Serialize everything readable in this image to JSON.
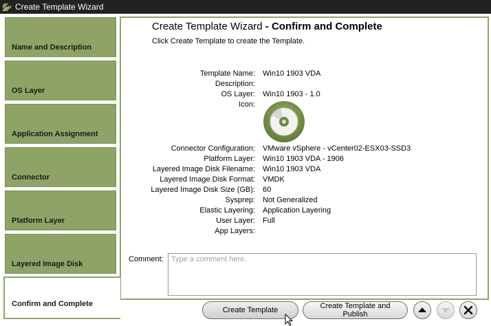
{
  "window": {
    "title": "Create Template Wizard"
  },
  "steps": [
    {
      "label": "Name and Description"
    },
    {
      "label": "OS Layer"
    },
    {
      "label": "Application Assignment"
    },
    {
      "label": "Connector"
    },
    {
      "label": "Platform Layer"
    },
    {
      "label": "Layered Image Disk"
    },
    {
      "label": "Confirm and Complete"
    }
  ],
  "header": {
    "title_prefix": "Create Template Wizard",
    "title_strong": " - Confirm and Complete",
    "subtitle": "Click Create Template to create the Template."
  },
  "details": {
    "template_name": {
      "label": "Template Name:",
      "value": "Win10 1903 VDA"
    },
    "description": {
      "label": "Description:",
      "value": ""
    },
    "os_layer": {
      "label": "OS Layer:",
      "value": "Win10 1903 - 1.0"
    },
    "icon": {
      "label": "Icon:",
      "icon_name": "disc-icon"
    },
    "connector": {
      "label": "Connector Configuration:",
      "value": "VMware vSphere - vCenter02-ESX03-SSD3"
    },
    "platform_layer": {
      "label": "Platform Layer:",
      "value": "Win10 1903 VDA - 1906"
    },
    "disk_filename": {
      "label": "Layered Image Disk Filename:",
      "value": "Win10 1903 VDA"
    },
    "disk_format": {
      "label": "Layered Image Disk Format:",
      "value": "VMDK"
    },
    "disk_size": {
      "label": "Layered Image Disk Size (GB):",
      "value": "60"
    },
    "sysprep": {
      "label": "Sysprep:",
      "value": "Not Generalized"
    },
    "elastic_layering": {
      "label": "Elastic Layering:",
      "value": "Application Layering"
    },
    "user_layer": {
      "label": "User Layer:",
      "value": "Full"
    },
    "app_layers": {
      "label": "App Layers:",
      "value": ""
    }
  },
  "comment": {
    "label": "Comment:",
    "value": "",
    "placeholder": "Type a comment here."
  },
  "buttons": {
    "create": "Create Template",
    "create_publish": "Create Template and Publish"
  },
  "colors": {
    "accent": "#8da466",
    "titlebar": "#222222"
  }
}
